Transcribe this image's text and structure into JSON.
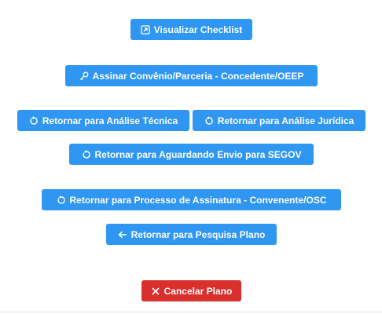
{
  "actions": {
    "visualizar_checklist": {
      "label": "Visualizar Checklist",
      "icon": "external-view-icon"
    },
    "assinar_convenio": {
      "label": "Assinar Convênio/Parceria - Concedente/OEEP",
      "icon": "key-icon"
    },
    "retornar_analise_tecnica": {
      "label": "Retornar para Análise Técnica",
      "icon": "undo-icon"
    },
    "retornar_analise_juridica": {
      "label": "Retornar para Análise Jurídica",
      "icon": "undo-icon"
    },
    "retornar_aguardando_segov": {
      "label": "Retornar para Aguardando Envio para SEGOV",
      "icon": "undo-icon"
    },
    "retornar_processo_assinatura": {
      "label": "Retornar para Processo de Assinatura - Convenente/OSC",
      "icon": "undo-icon"
    },
    "retornar_pesquisa_plano": {
      "label": "Retornar para Pesquisa Plano",
      "icon": "arrow-left-icon"
    },
    "cancelar_plano": {
      "label": "Cancelar Plano",
      "icon": "close-icon"
    }
  },
  "colors": {
    "primary": "#2f96f2",
    "danger": "#d9302e",
    "text_on_button": "#ffffff"
  }
}
